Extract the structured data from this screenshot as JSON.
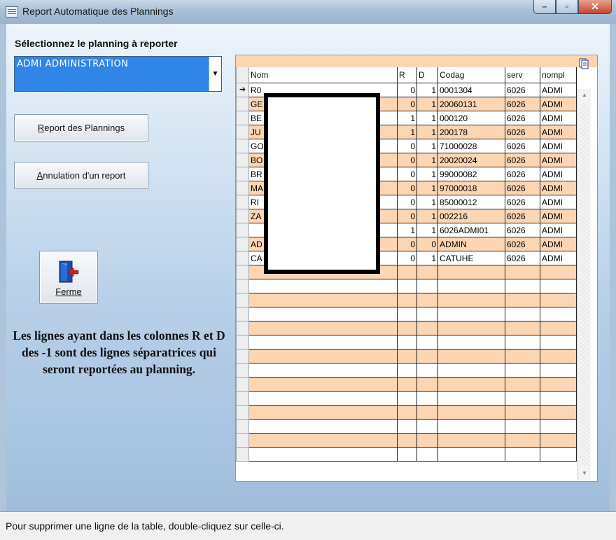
{
  "window": {
    "title": "Report Automatique des Plannings",
    "controls": [
      "minimize-icon",
      "maximize-icon",
      "close-icon"
    ]
  },
  "prompt_label": "Sélectionnez le planning à reporter",
  "planning_select": {
    "value": "ADMI  ADMINISTRATION"
  },
  "buttons": {
    "report": {
      "prefix": "",
      "accel": "R",
      "rest": "eport des Plannings"
    },
    "cancel_report": {
      "prefix": "",
      "accel": "A",
      "rest": "nnulation d'un report"
    },
    "close": {
      "label": "Ferme",
      "icon": "exit-door-icon"
    }
  },
  "note": "Les lignes ayant dans les colonnes R et D des -1 sont des lignes séparatrices qui seront reportées au planning.",
  "grid": {
    "columns": [
      "Nom",
      "R",
      "D",
      "Codag",
      "serv",
      "nompl"
    ],
    "rows": [
      {
        "nom": "R0",
        "r": "0",
        "d": "1",
        "codag": "0001304",
        "serv": "6026",
        "nompl": "ADMI",
        "current": true
      },
      {
        "nom": "GE",
        "r": "0",
        "d": "1",
        "codag": "20060131",
        "serv": "6026",
        "nompl": "ADMI"
      },
      {
        "nom": "BE",
        "r": "1",
        "d": "1",
        "codag": "000120",
        "serv": "6026",
        "nompl": "ADMI"
      },
      {
        "nom": "JU",
        "r": "1",
        "d": "1",
        "codag": "200178",
        "serv": "6026",
        "nompl": "ADMI"
      },
      {
        "nom": "GO",
        "r": "0",
        "d": "1",
        "codag": "71000028",
        "serv": "6026",
        "nompl": "ADMI"
      },
      {
        "nom": "BO",
        "r": "0",
        "d": "1",
        "codag": "20020024",
        "serv": "6026",
        "nompl": "ADMI"
      },
      {
        "nom": "BR",
        "r": "0",
        "d": "1",
        "codag": "99000082",
        "serv": "6026",
        "nompl": "ADMI"
      },
      {
        "nom": "MA",
        "r": "0",
        "d": "1",
        "codag": "97000018",
        "serv": "6026",
        "nompl": "ADMI"
      },
      {
        "nom": "RI",
        "r": "0",
        "d": "1",
        "codag": "85000012",
        "serv": "6026",
        "nompl": "ADMI"
      },
      {
        "nom": "ZA",
        "r": "0",
        "d": "1",
        "codag": "002216",
        "serv": "6026",
        "nompl": "ADMI"
      },
      {
        "nom": "",
        "r": "1",
        "d": "1",
        "codag": "6026ADMI01",
        "serv": "6026",
        "nompl": "ADMI"
      },
      {
        "nom": "AD",
        "r": "0",
        "d": "0",
        "codag": "ADMIN",
        "serv": "6026",
        "nompl": "ADMI"
      },
      {
        "nom": "CA",
        "r": "0",
        "d": "1",
        "codag": "CATUHE",
        "serv": "6026",
        "nompl": "ADMI"
      }
    ],
    "empty_rows": 14
  },
  "status_bar": "Pour supprimer une ligne de la table, double-cliquez sur celle-ci."
}
